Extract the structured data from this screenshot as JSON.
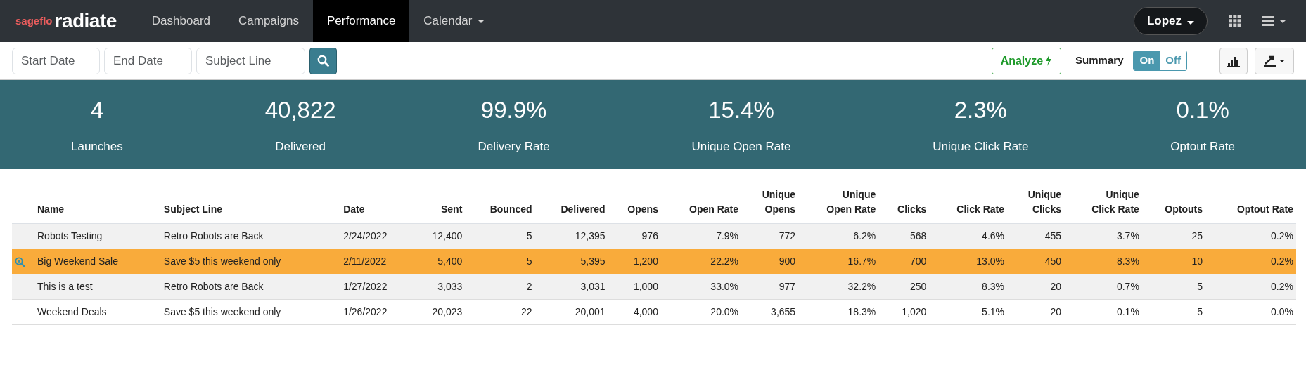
{
  "brand": {
    "prefix": "sageflo",
    "name": "radiate"
  },
  "nav": [
    {
      "label": "Dashboard",
      "selected": false,
      "dropdown": false
    },
    {
      "label": "Campaigns",
      "selected": false,
      "dropdown": false
    },
    {
      "label": "Performance",
      "selected": true,
      "dropdown": false
    },
    {
      "label": "Calendar",
      "selected": false,
      "dropdown": true
    }
  ],
  "user": {
    "label": "Lopez"
  },
  "filters": [
    {
      "placeholder": "Start Date"
    },
    {
      "placeholder": "End Date"
    },
    {
      "placeholder": "Subject Line"
    }
  ],
  "analyze": {
    "label": "Analyze"
  },
  "summary": {
    "label": "Summary",
    "options": [
      {
        "label": "On",
        "selected": true
      },
      {
        "label": "Off",
        "selected": false
      }
    ]
  },
  "stats": [
    {
      "value": "4",
      "label": "Launches"
    },
    {
      "value": "40,822",
      "label": "Delivered"
    },
    {
      "value": "99.9%",
      "label": "Delivery Rate"
    },
    {
      "value": "15.4%",
      "label": "Unique Open Rate"
    },
    {
      "value": "2.3%",
      "label": "Unique Click Rate"
    },
    {
      "value": "0.1%",
      "label": "Optout Rate"
    }
  ],
  "table": {
    "columns": [
      "Name",
      "Subject Line",
      "Date",
      "Sent",
      "Bounced",
      "Delivered",
      "Opens",
      "Open Rate",
      "Unique\nOpens",
      "Unique\nOpen Rate",
      "Clicks",
      "Click Rate",
      "Unique\nClicks",
      "Unique\nClick Rate",
      "Optouts",
      "Optout Rate"
    ],
    "rows": [
      {
        "selected": false,
        "cells": [
          "Robots Testing",
          "Retro Robots are Back",
          "2/24/2022",
          "12,400",
          "5",
          "12,395",
          "976",
          "7.9%",
          "772",
          "6.2%",
          "568",
          "4.6%",
          "455",
          "3.7%",
          "25",
          "0.2%"
        ]
      },
      {
        "selected": true,
        "cells": [
          "Big Weekend Sale",
          "Save $5 this weekend only",
          "2/11/2022",
          "5,400",
          "5",
          "5,395",
          "1,200",
          "22.2%",
          "900",
          "16.7%",
          "700",
          "13.0%",
          "450",
          "8.3%",
          "10",
          "0.2%"
        ]
      },
      {
        "selected": false,
        "cells": [
          "This is a test",
          "Retro Robots are Back",
          "1/27/2022",
          "3,033",
          "2",
          "3,031",
          "1,000",
          "33.0%",
          "977",
          "32.2%",
          "250",
          "8.3%",
          "20",
          "0.7%",
          "5",
          "0.2%"
        ]
      },
      {
        "selected": false,
        "cells": [
          "Weekend Deals",
          "Save $5 this weekend only",
          "1/26/2022",
          "20,023",
          "22",
          "20,001",
          "4,000",
          "20.0%",
          "3,655",
          "18.3%",
          "1,020",
          "5.1%",
          "20",
          "0.1%",
          "5",
          "0.0%"
        ]
      }
    ]
  }
}
